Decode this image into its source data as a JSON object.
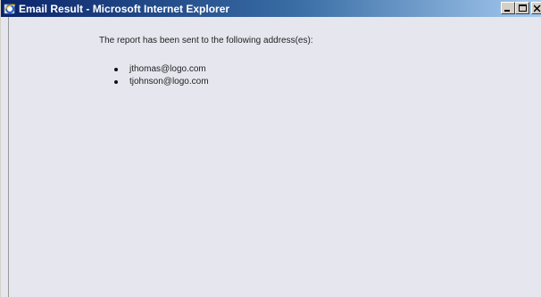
{
  "window": {
    "title": "Email Result - Microsoft Internet Explorer",
    "icon": "internet-explorer-icon"
  },
  "content": {
    "message": "The report has been sent to the following address(es):",
    "addresses": [
      "jthomas@logo.com",
      "tjohnson@logo.com"
    ]
  },
  "colors": {
    "titlebar_start": "#0a246a",
    "titlebar_end": "#a6caf0",
    "background": "#e6e6ef"
  }
}
